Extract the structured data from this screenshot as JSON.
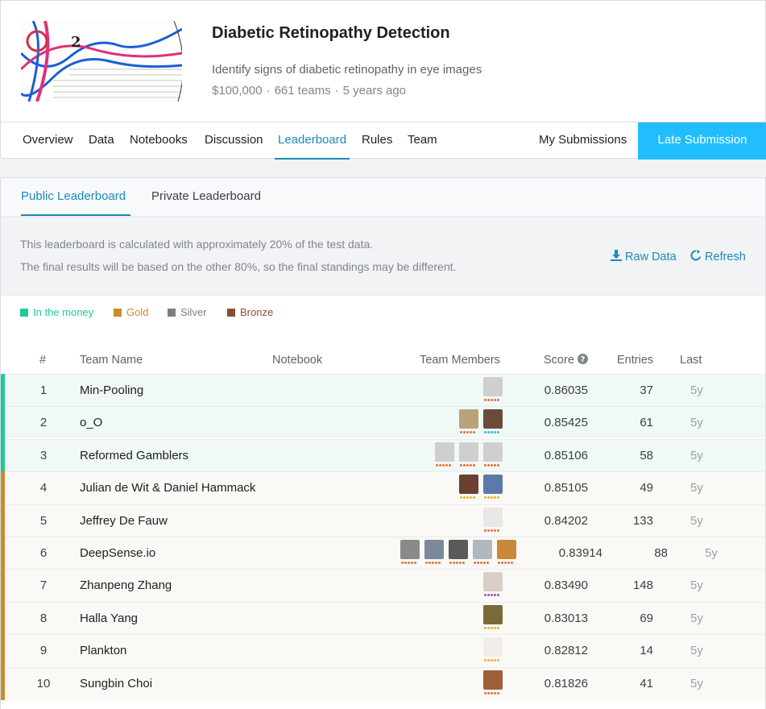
{
  "competition": {
    "title": "Diabetic Retinopathy Detection",
    "subtitle": "Identify signs of diabetic retinopathy in eye images",
    "prize": "$100,000",
    "teams": "661 teams",
    "age": "5 years ago"
  },
  "nav": {
    "items": [
      "Overview",
      "Data",
      "Notebooks",
      "Discussion",
      "Leaderboard",
      "Rules",
      "Team"
    ],
    "active": "Leaderboard",
    "my_submissions": "My Submissions",
    "late_submission": "Late Submission"
  },
  "leaderboard": {
    "tabs": [
      "Public Leaderboard",
      "Private Leaderboard"
    ],
    "active_tab": "Public Leaderboard",
    "info_line1": "This leaderboard is calculated with approximately 20% of the test data.",
    "info_line2": "The final results will be based on the other 80%, so the final standings may be different.",
    "raw_data": "Raw Data",
    "refresh": "Refresh",
    "legend": [
      {
        "label": "In the money",
        "color": "#20c997"
      },
      {
        "label": "Gold",
        "color": "#c78e2e"
      },
      {
        "label": "Silver",
        "color": "#7d7d7d"
      },
      {
        "label": "Bronze",
        "color": "#8b4d34"
      }
    ],
    "columns": {
      "rank": "#",
      "team": "Team Name",
      "notebook": "Notebook",
      "members": "Team Members",
      "score": "Score",
      "entries": "Entries",
      "last": "Last"
    },
    "rows": [
      {
        "rank": "1",
        "team": "Min-Pooling",
        "score": "0.86035",
        "entries": "37",
        "last": "5y",
        "medal": "money",
        "avatars": [
          "#cfcfcf"
        ],
        "tiers": [
          "#e8703a"
        ]
      },
      {
        "rank": "2",
        "team": "o_O",
        "score": "0.85425",
        "entries": "61",
        "last": "5y",
        "medal": "money",
        "avatars": [
          "#b9a37a",
          "#6b4a3c"
        ],
        "tiers": [
          "#e8703a",
          "#20beff"
        ]
      },
      {
        "rank": "3",
        "team": "Reformed Gamblers",
        "score": "0.85106",
        "entries": "58",
        "last": "5y",
        "medal": "money",
        "avatars": [
          "#cfcfcf",
          "#cfcfcf",
          "#cfcfcf"
        ],
        "tiers": [
          "#e8703a",
          "#e8703a",
          "#e8703a"
        ]
      },
      {
        "rank": "4",
        "team": "Julian de Wit & Daniel Hammack",
        "score": "0.85105",
        "entries": "49",
        "last": "5y",
        "medal": "gold",
        "avatars": [
          "#6a4030",
          "#5a7aa8"
        ],
        "tiers": [
          "#e8b02e",
          "#e8b02e"
        ]
      },
      {
        "rank": "5",
        "team": "Jeffrey De Fauw",
        "score": "0.84202",
        "entries": "133",
        "last": "5y",
        "medal": "gold",
        "avatars": [
          "#e8e8e8"
        ],
        "tiers": [
          "#e8703a"
        ]
      },
      {
        "rank": "6",
        "team": "DeepSense.io",
        "score": "0.83914",
        "entries": "88",
        "last": "5y",
        "medal": "gold",
        "avatars": [
          "#8a8a8a",
          "#7a8a9a",
          "#5a5a5a",
          "#b0b8c0",
          "#c88a3a"
        ],
        "tiers": [
          "#e8703a",
          "#e8703a",
          "#e8703a",
          "#e8703a",
          "#e8703a"
        ]
      },
      {
        "rank": "7",
        "team": "Zhanpeng Zhang",
        "score": "0.83490",
        "entries": "148",
        "last": "5y",
        "medal": "gold",
        "avatars": [
          "#d8d0c8"
        ],
        "tiers": [
          "#8e5ab8"
        ]
      },
      {
        "rank": "8",
        "team": "Halla Yang",
        "score": "0.83013",
        "entries": "69",
        "last": "5y",
        "medal": "gold",
        "avatars": [
          "#7a6a3a"
        ],
        "tiers": [
          "#e8b02e"
        ]
      },
      {
        "rank": "9",
        "team": "Plankton",
        "score": "0.82812",
        "entries": "14",
        "last": "5y",
        "medal": "gold",
        "avatars": [
          "#f0ece8"
        ],
        "tiers": [
          "#e8b02e"
        ]
      },
      {
        "rank": "10",
        "team": "Sungbin Choi",
        "score": "0.81826",
        "entries": "41",
        "last": "5y",
        "medal": "gold",
        "avatars": [
          "#a0603a"
        ],
        "tiers": [
          "#e8703a"
        ]
      }
    ]
  },
  "colors": {
    "accent": "#1a8bb8",
    "late_button": "#20beff",
    "money_row_bg": "#f1f9f6",
    "gold_row_bg": "#fbf9f6",
    "money_bar": "#20c997",
    "gold_bar": "#c78e2e"
  }
}
